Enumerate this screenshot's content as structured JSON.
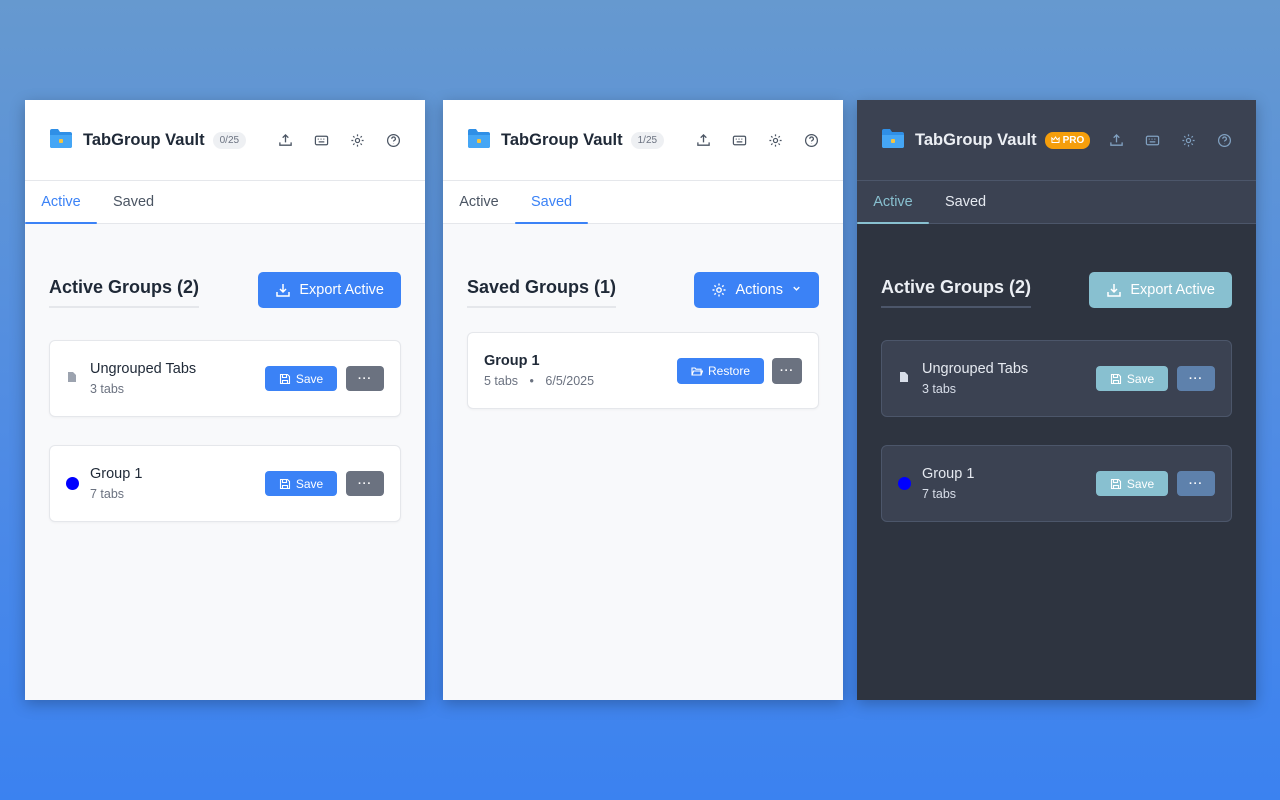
{
  "app": {
    "title": "TabGroup Vault",
    "pro_label": "PRO"
  },
  "colors": {
    "accent": "#3b82f6",
    "dark_accent": "#88c0d0",
    "pro": "#f59e0b",
    "group_dot": "#0000ff"
  },
  "panels": [
    {
      "count": "0/25",
      "tabs": [
        "Active",
        "Saved"
      ],
      "active_tab": "Active",
      "section_title": "Active Groups (2)",
      "action_label": "Export Active",
      "cards": [
        {
          "icon": "document-icon",
          "name": "Ungrouped Tabs",
          "sub": "3 tabs",
          "button": "Save"
        },
        {
          "icon": "color-dot",
          "name": "Group 1",
          "sub": "7 tabs",
          "button": "Save"
        }
      ]
    },
    {
      "count": "1/25",
      "tabs": [
        "Active",
        "Saved"
      ],
      "active_tab": "Saved",
      "section_title": "Saved Groups (1)",
      "action_label": "Actions",
      "cards": [
        {
          "name": "Group 1",
          "tabs": "5 tabs",
          "sep": "•",
          "date": "6/5/2025",
          "button": "Restore"
        }
      ]
    },
    {
      "theme": "dark",
      "tabs": [
        "Active",
        "Saved"
      ],
      "active_tab": "Active",
      "section_title": "Active Groups (2)",
      "action_label": "Export Active",
      "cards": [
        {
          "icon": "document-icon",
          "name": "Ungrouped Tabs",
          "sub": "3 tabs",
          "button": "Save"
        },
        {
          "icon": "color-dot",
          "name": "Group 1",
          "sub": "7 tabs",
          "button": "Save"
        }
      ]
    }
  ],
  "more_label": "···"
}
